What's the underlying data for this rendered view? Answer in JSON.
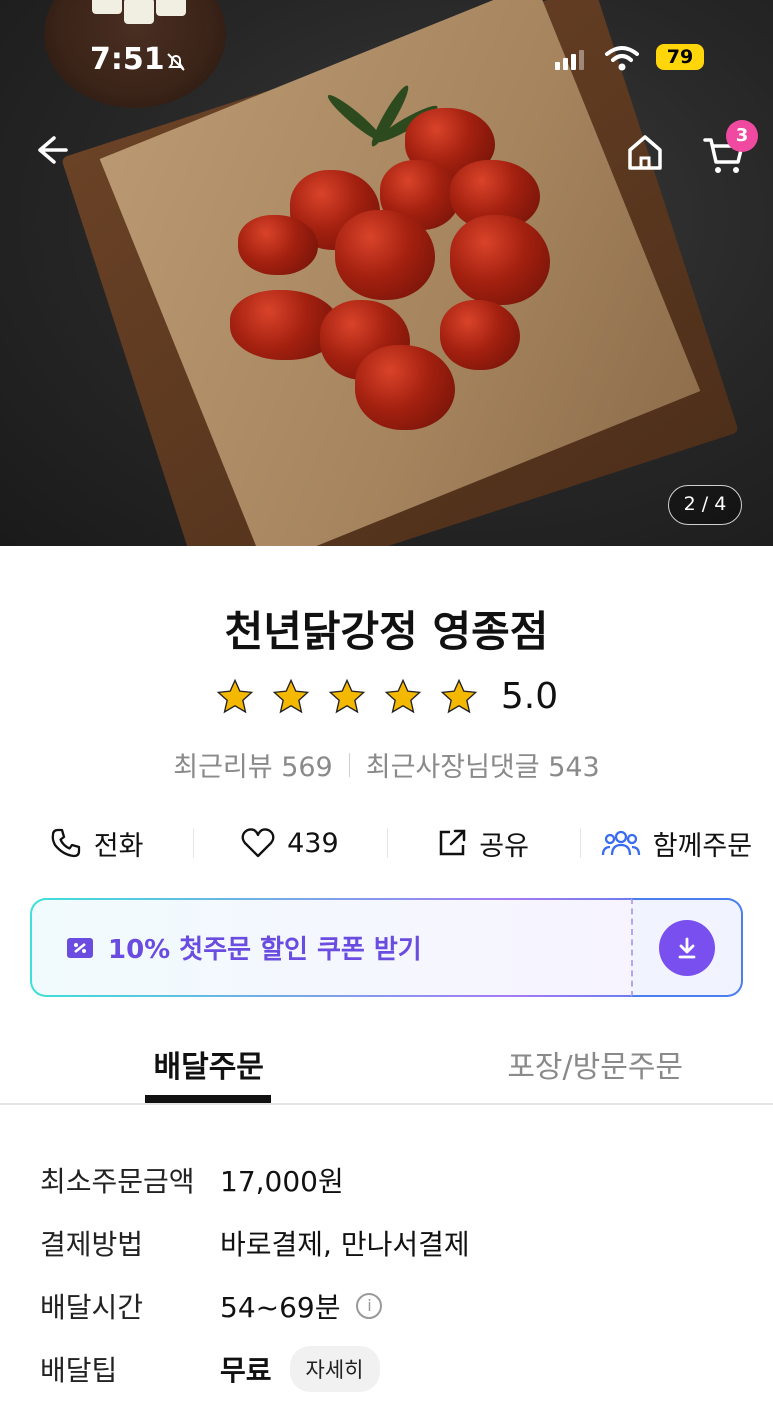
{
  "status_bar": {
    "time": "7:51",
    "battery": "79"
  },
  "header": {
    "cart_count": "3",
    "image_pager": "2 / 4"
  },
  "store": {
    "name": "천년닭강정 영종점",
    "rating": "5.0",
    "stars": 5,
    "recent_reviews": "최근리뷰 569",
    "owner_replies": "최근사장님댓글 543"
  },
  "actions": [
    {
      "label": "전화",
      "icon": "phone-icon"
    },
    {
      "label": "439",
      "icon": "heart-icon"
    },
    {
      "label": "공유",
      "icon": "share-icon"
    },
    {
      "label": "함께주문",
      "icon": "group-icon"
    }
  ],
  "coupon": {
    "text": "10% 첫주문 할인 쿠폰 받기",
    "accent": "#6a4ce0"
  },
  "tabs": [
    "배달주문",
    "포장/방문주문"
  ],
  "details": [
    {
      "key": "최소주문금액",
      "value": "17,000원"
    },
    {
      "key": "결제방법",
      "value": "바로결제, 만나서결제"
    },
    {
      "key": "배달시간",
      "value": "54~69분"
    },
    {
      "key": "배달팁",
      "value": "무료",
      "chip": "자세히"
    }
  ]
}
